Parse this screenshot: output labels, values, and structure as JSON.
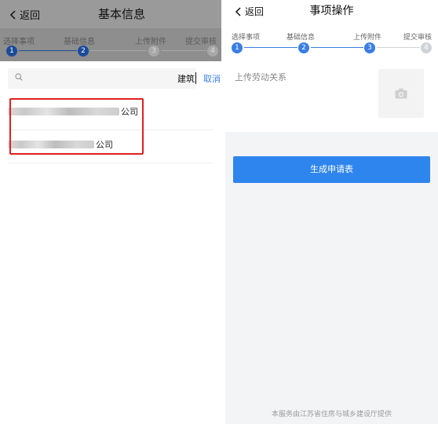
{
  "left": {
    "header": {
      "back_label": "返回",
      "title": "基本信息"
    },
    "steps": [
      {
        "label": "选择事项",
        "number": "1",
        "status": "done"
      },
      {
        "label": "基础信息",
        "number": "2",
        "status": "done"
      },
      {
        "label": "上传附件",
        "number": "3",
        "status": "todo"
      },
      {
        "label": "提交审核",
        "number": "4",
        "status": "todo"
      }
    ],
    "search": {
      "value": "建筑",
      "cancel_label": "取消"
    },
    "results": [
      {
        "suffix": "公司"
      },
      {
        "suffix": "公司"
      }
    ]
  },
  "right": {
    "header": {
      "back_label": "返回",
      "title": "事项操作"
    },
    "steps": [
      {
        "label": "选择事项",
        "number": "1",
        "status": "done"
      },
      {
        "label": "基础信息",
        "number": "2",
        "status": "done"
      },
      {
        "label": "上传附件",
        "number": "3",
        "status": "done"
      },
      {
        "label": "提交审核",
        "number": "4",
        "status": "todo"
      }
    ],
    "upload_label": "上传劳动关系",
    "generate_label": "生成申请表",
    "footer_note": "本服务由江苏省住房与城乡建设厅提供"
  },
  "colors": {
    "accent": "#2f85ee",
    "step_active_dark": "#1b4b99",
    "highlight": "#e02020",
    "cancel_link": "#3d82e6"
  },
  "icons": {
    "back": "chevron-left-icon",
    "search": "search-icon",
    "upload": "camera-icon"
  }
}
